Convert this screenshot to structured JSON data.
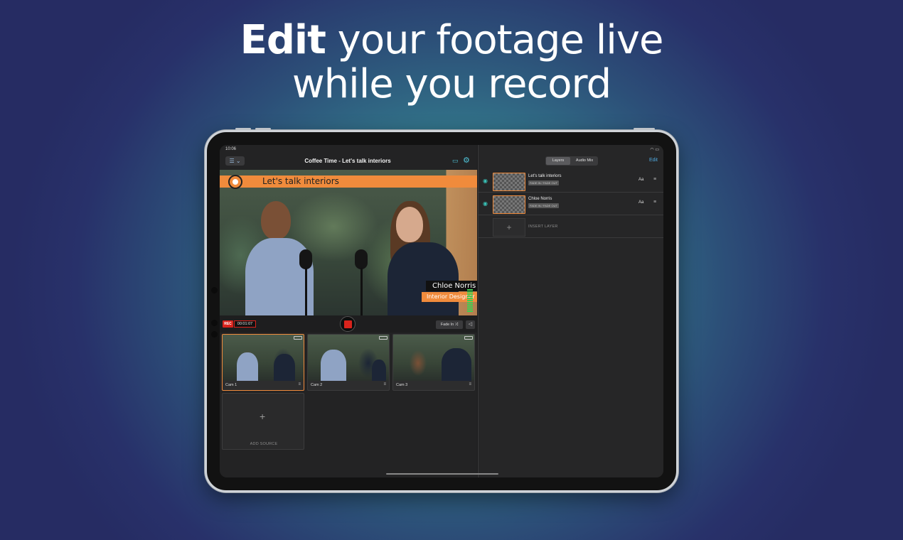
{
  "headline": {
    "bold": "Edit",
    "line1_rest": " your footage live",
    "line2": "while you record"
  },
  "status_bar": {
    "time": "10:06"
  },
  "app": {
    "title": "Coffee Time - Let's talk interiors",
    "menu_icon": "list-icon",
    "monitor_icon": "monitor-icon",
    "settings_icon": "gear-icon"
  },
  "preview": {
    "banner_text": "Let's talk interiors",
    "lower_third_name": "Chloe Norris",
    "lower_third_role": "Interior Designer"
  },
  "controls": {
    "rec_label": "REC",
    "rec_time": "00:01:07",
    "fade_label": "Fade In",
    "fade_icon": "shuffle-icon",
    "audio_icon": "speaker-icon"
  },
  "sources": [
    {
      "label": "Cam 1",
      "selected": true
    },
    {
      "label": "Cam 2",
      "selected": false
    },
    {
      "label": "Cam 3",
      "selected": false
    }
  ],
  "add_source_label": "ADD SOURCE",
  "right_panel": {
    "tabs": [
      {
        "label": "Layers",
        "active": true
      },
      {
        "label": "Audio Mix",
        "active": false
      }
    ],
    "edit_label": "Edit",
    "layers": [
      {
        "name": "Let's talk interiors",
        "transition": "FADE IN / FADE OUT",
        "text_btn": "Aa"
      },
      {
        "name": "Chloe Norris",
        "transition": "FADE IN / FADE OUT",
        "text_btn": "Aa"
      }
    ],
    "insert_label": "INSERT LAYER"
  },
  "colors": {
    "accent_orange": "#f08b3c",
    "record_red": "#d9231c",
    "link_blue": "#4fa9e0",
    "eye_teal": "#39c3b8"
  }
}
